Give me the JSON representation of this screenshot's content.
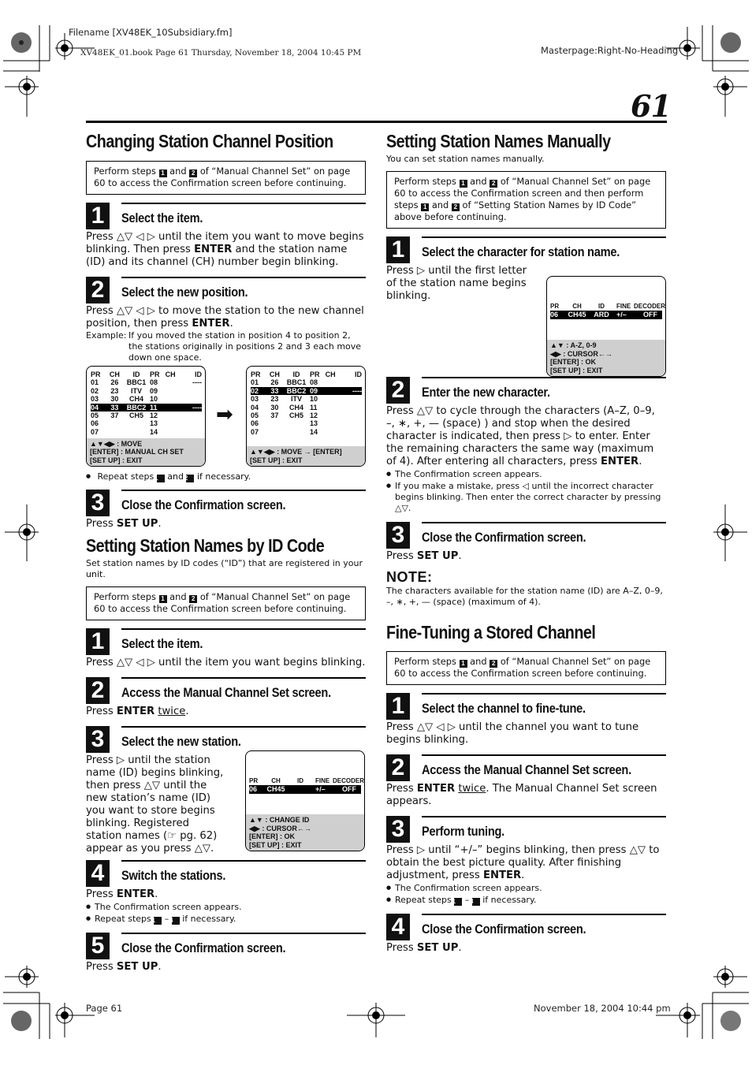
{
  "print_meta": {
    "filename": "Filename [XV48EK_10Subsidiary.fm]",
    "book_line": "XV48EK_01.book  Page 61  Thursday, November 18, 2004  10:45 PM",
    "masterpage": "Masterpage:Right-No-Heading",
    "footer_page": "Page 61",
    "footer_date": "November 18, 2004 10:44 pm"
  },
  "page_number": "61",
  "left": {
    "section1": {
      "title": "Changing Station Channel Position",
      "box": {
        "a": "Perform steps ",
        "n1": "1",
        "and": " and ",
        "n2": "2",
        "b": " of “Manual Channel Set” on page 60 to access the Confirmation screen before continuing."
      },
      "steps": [
        {
          "num": "1",
          "title": "Select the item.",
          "p1": "Press △▽ ◁ ▷ until the item you want to move begins blinking. Then press ",
          "b1": "ENTER",
          "p2": " and the station name (ID) and its channel (CH) number begin blinking."
        },
        {
          "num": "2",
          "title": "Select the new position.",
          "p1": "Press △▽ ◁ ▷ to move the station to the new channel position, then press ",
          "b1": "ENTER",
          "p2": ".",
          "example_label": "Example:",
          "example": "If you moved the station in position 4 to position 2, the stations originally in positions 2 and 3 each move down one space."
        },
        {
          "num": "3",
          "title": "Close the Confirmation screen.",
          "p1": "Press ",
          "b1": "SET UP",
          "p2": "."
        }
      ],
      "repeat_note": {
        "a": "Repeat steps ",
        "n1": "1",
        "and": " and ",
        "n2": "2",
        "b": " if necessary."
      },
      "screen_before": {
        "headers": [
          "PR",
          "CH",
          "ID",
          "PR",
          "CH",
          "ID"
        ],
        "rows": [
          [
            "01",
            "26",
            "BBC1",
            "08",
            "",
            "----"
          ],
          [
            "02",
            "23",
            "ITV",
            "09",
            "",
            ""
          ],
          [
            "03",
            "30",
            "CH4",
            "10",
            "",
            ""
          ],
          [
            "04",
            "33",
            "BBC2",
            "11",
            "",
            "----"
          ],
          [
            "05",
            "37",
            "CH5",
            "12",
            "",
            ""
          ],
          [
            "06",
            "",
            "",
            "13",
            "",
            ""
          ],
          [
            "07",
            "",
            "",
            "14",
            "",
            ""
          ]
        ],
        "selected_row": 3,
        "footer": [
          "▲▼◀▶ : MOVE",
          "[ENTER] : MANUAL CH SET",
          "[SET UP] : EXIT"
        ]
      },
      "arrow": "➡",
      "screen_after": {
        "headers": [
          "PR",
          "CH",
          "ID",
          "PR",
          "CH",
          "ID"
        ],
        "rows": [
          [
            "01",
            "26",
            "BBC1",
            "08",
            "",
            ""
          ],
          [
            "02",
            "33",
            "BBC2",
            "09",
            "",
            "----"
          ],
          [
            "03",
            "23",
            "ITV",
            "10",
            "",
            ""
          ],
          [
            "04",
            "30",
            "CH4",
            "11",
            "",
            ""
          ],
          [
            "05",
            "37",
            "CH5",
            "12",
            "",
            ""
          ],
          [
            "06",
            "",
            "",
            "13",
            "",
            ""
          ],
          [
            "07",
            "",
            "",
            "14",
            "",
            ""
          ]
        ],
        "selected_row": 1,
        "footer": [
          "▲▼◀▶ : MOVE → [ENTER]",
          "[SET UP] : EXIT"
        ]
      }
    },
    "section2": {
      "title": "Setting Station Names by ID Code",
      "intro": "Set station names by ID codes (“ID”) that are registered in your unit.",
      "box": {
        "a": "Perform steps ",
        "n1": "1",
        "and": " and ",
        "n2": "2",
        "b": " of “Manual Channel Set” on page 60 to access the Confirmation screen before continuing."
      },
      "steps": [
        {
          "num": "1",
          "title": "Select the item.",
          "p1": "Press △▽ ◁ ▷ until the item you want begins blinking."
        },
        {
          "num": "2",
          "title": "Access the Manual Channel Set screen.",
          "p1": "Press ",
          "b1": "ENTER",
          "u1": "twice",
          "p2": "."
        },
        {
          "num": "3",
          "title": "Select the new station.",
          "p1": "Press ▷ until the station name (ID) begins blinking, then press △▽ until the new station’s name (ID) you want to store begins blinking. Registered station names (☞ pg. 62) appear as you press △▽."
        },
        {
          "num": "4",
          "title": "Switch the stations.",
          "p1": "Press ",
          "b1": "ENTER",
          "p2": ".",
          "bullets": [
            "The Confirmation screen appears."
          ],
          "repeat": {
            "a": "Repeat steps ",
            "n1": "1",
            "dash": " – ",
            "n2": "4",
            "b": " if necessary."
          }
        },
        {
          "num": "5",
          "title": "Close the Confirmation screen.",
          "p1": "Press ",
          "b1": "SET UP",
          "p2": "."
        }
      ],
      "screen": {
        "headers": [
          "PR",
          "CH",
          "ID",
          "FINE",
          "DECODER"
        ],
        "row": [
          "06",
          "CH45",
          "",
          "+/–",
          "OFF"
        ],
        "footer": [
          "▲▼ : CHANGE ID",
          "◀▶ : CURSOR←→",
          "[ENTER] : OK",
          "[SET UP] : EXIT"
        ]
      }
    }
  },
  "right": {
    "section3": {
      "title": "Setting Station Names Manually",
      "intro": "You can set station names manually.",
      "box": {
        "a": "Perform steps ",
        "n1": "1",
        "and": " and ",
        "n2": "2",
        "b": " of “Manual Channel Set” on page 60 to access the Confirmation screen and then perform steps ",
        "n3": "1",
        "and2": " and ",
        "n4": "2",
        "c": " of “Setting Station Names by ID Code” above before continuing."
      },
      "steps": [
        {
          "num": "1",
          "title": "Select the character for station name.",
          "p1": "Press ▷ until the first letter of the station name begins blinking."
        },
        {
          "num": "2",
          "title": "Enter the new character.",
          "p1": "Press △▽ to cycle through the characters (A–Z, 0–9, –, ∗, +, — (space) ) and stop when the desired character is indicated, then press ▷ to enter. Enter the remaining characters the same way (maximum of 4). After entering all characters, press ",
          "b1": "ENTER",
          "p2": ".",
          "bullets": [
            "The Confirmation screen appears.",
            "If you make a mistake, press ◁ until the incorrect character begins blinking. Then enter the correct character by pressing △▽."
          ]
        },
        {
          "num": "3",
          "title": "Close the Confirmation screen.",
          "p1": "Press ",
          "b1": "SET UP",
          "p2": "."
        }
      ],
      "note_title": "NOTE:",
      "note": "The characters available for the station name (ID) are A–Z, 0–9, –, ∗, +, — (space) (maximum of 4).",
      "screen": {
        "headers": [
          "PR",
          "CH",
          "ID",
          "FINE",
          "DECODER"
        ],
        "row": [
          "06",
          "CH45",
          "ARD",
          "+/–",
          "OFF"
        ],
        "footer": [
          "▲▼ : A-Z, 0-9",
          "◀▶ : CURSOR←→",
          "[ENTER] : OK",
          "[SET UP] : EXIT"
        ]
      }
    },
    "section4": {
      "title": "Fine-Tuning a Stored Channel",
      "box": {
        "a": "Perform steps ",
        "n1": "1",
        "and": " and ",
        "n2": "2",
        "b": " of “Manual Channel Set” on page 60 to access the Confirmation screen before continuing."
      },
      "steps": [
        {
          "num": "1",
          "title": "Select the channel to fine-tune.",
          "p1": "Press △▽ ◁ ▷ until the channel you want to tune begins blinking."
        },
        {
          "num": "2",
          "title": "Access the Manual Channel Set screen.",
          "p1": "Press ",
          "b1": "ENTER",
          "u1": "twice",
          "p2": ". The Manual Channel Set screen appears."
        },
        {
          "num": "3",
          "title": "Perform tuning.",
          "p1": "Press ▷ until “+/–” begins blinking, then press △▽ to obtain the best picture quality. After finishing adjustment, press ",
          "b1": "ENTER",
          "p2": ".",
          "bullets": [
            "The Confirmation screen appears."
          ],
          "repeat": {
            "a": "Repeat steps ",
            "n1": "1",
            "dash": " – ",
            "n2": "3",
            "b": " if necessary."
          }
        },
        {
          "num": "4",
          "title": "Close the Confirmation screen.",
          "p1": "Press ",
          "b1": "SET UP",
          "p2": "."
        }
      ]
    }
  }
}
